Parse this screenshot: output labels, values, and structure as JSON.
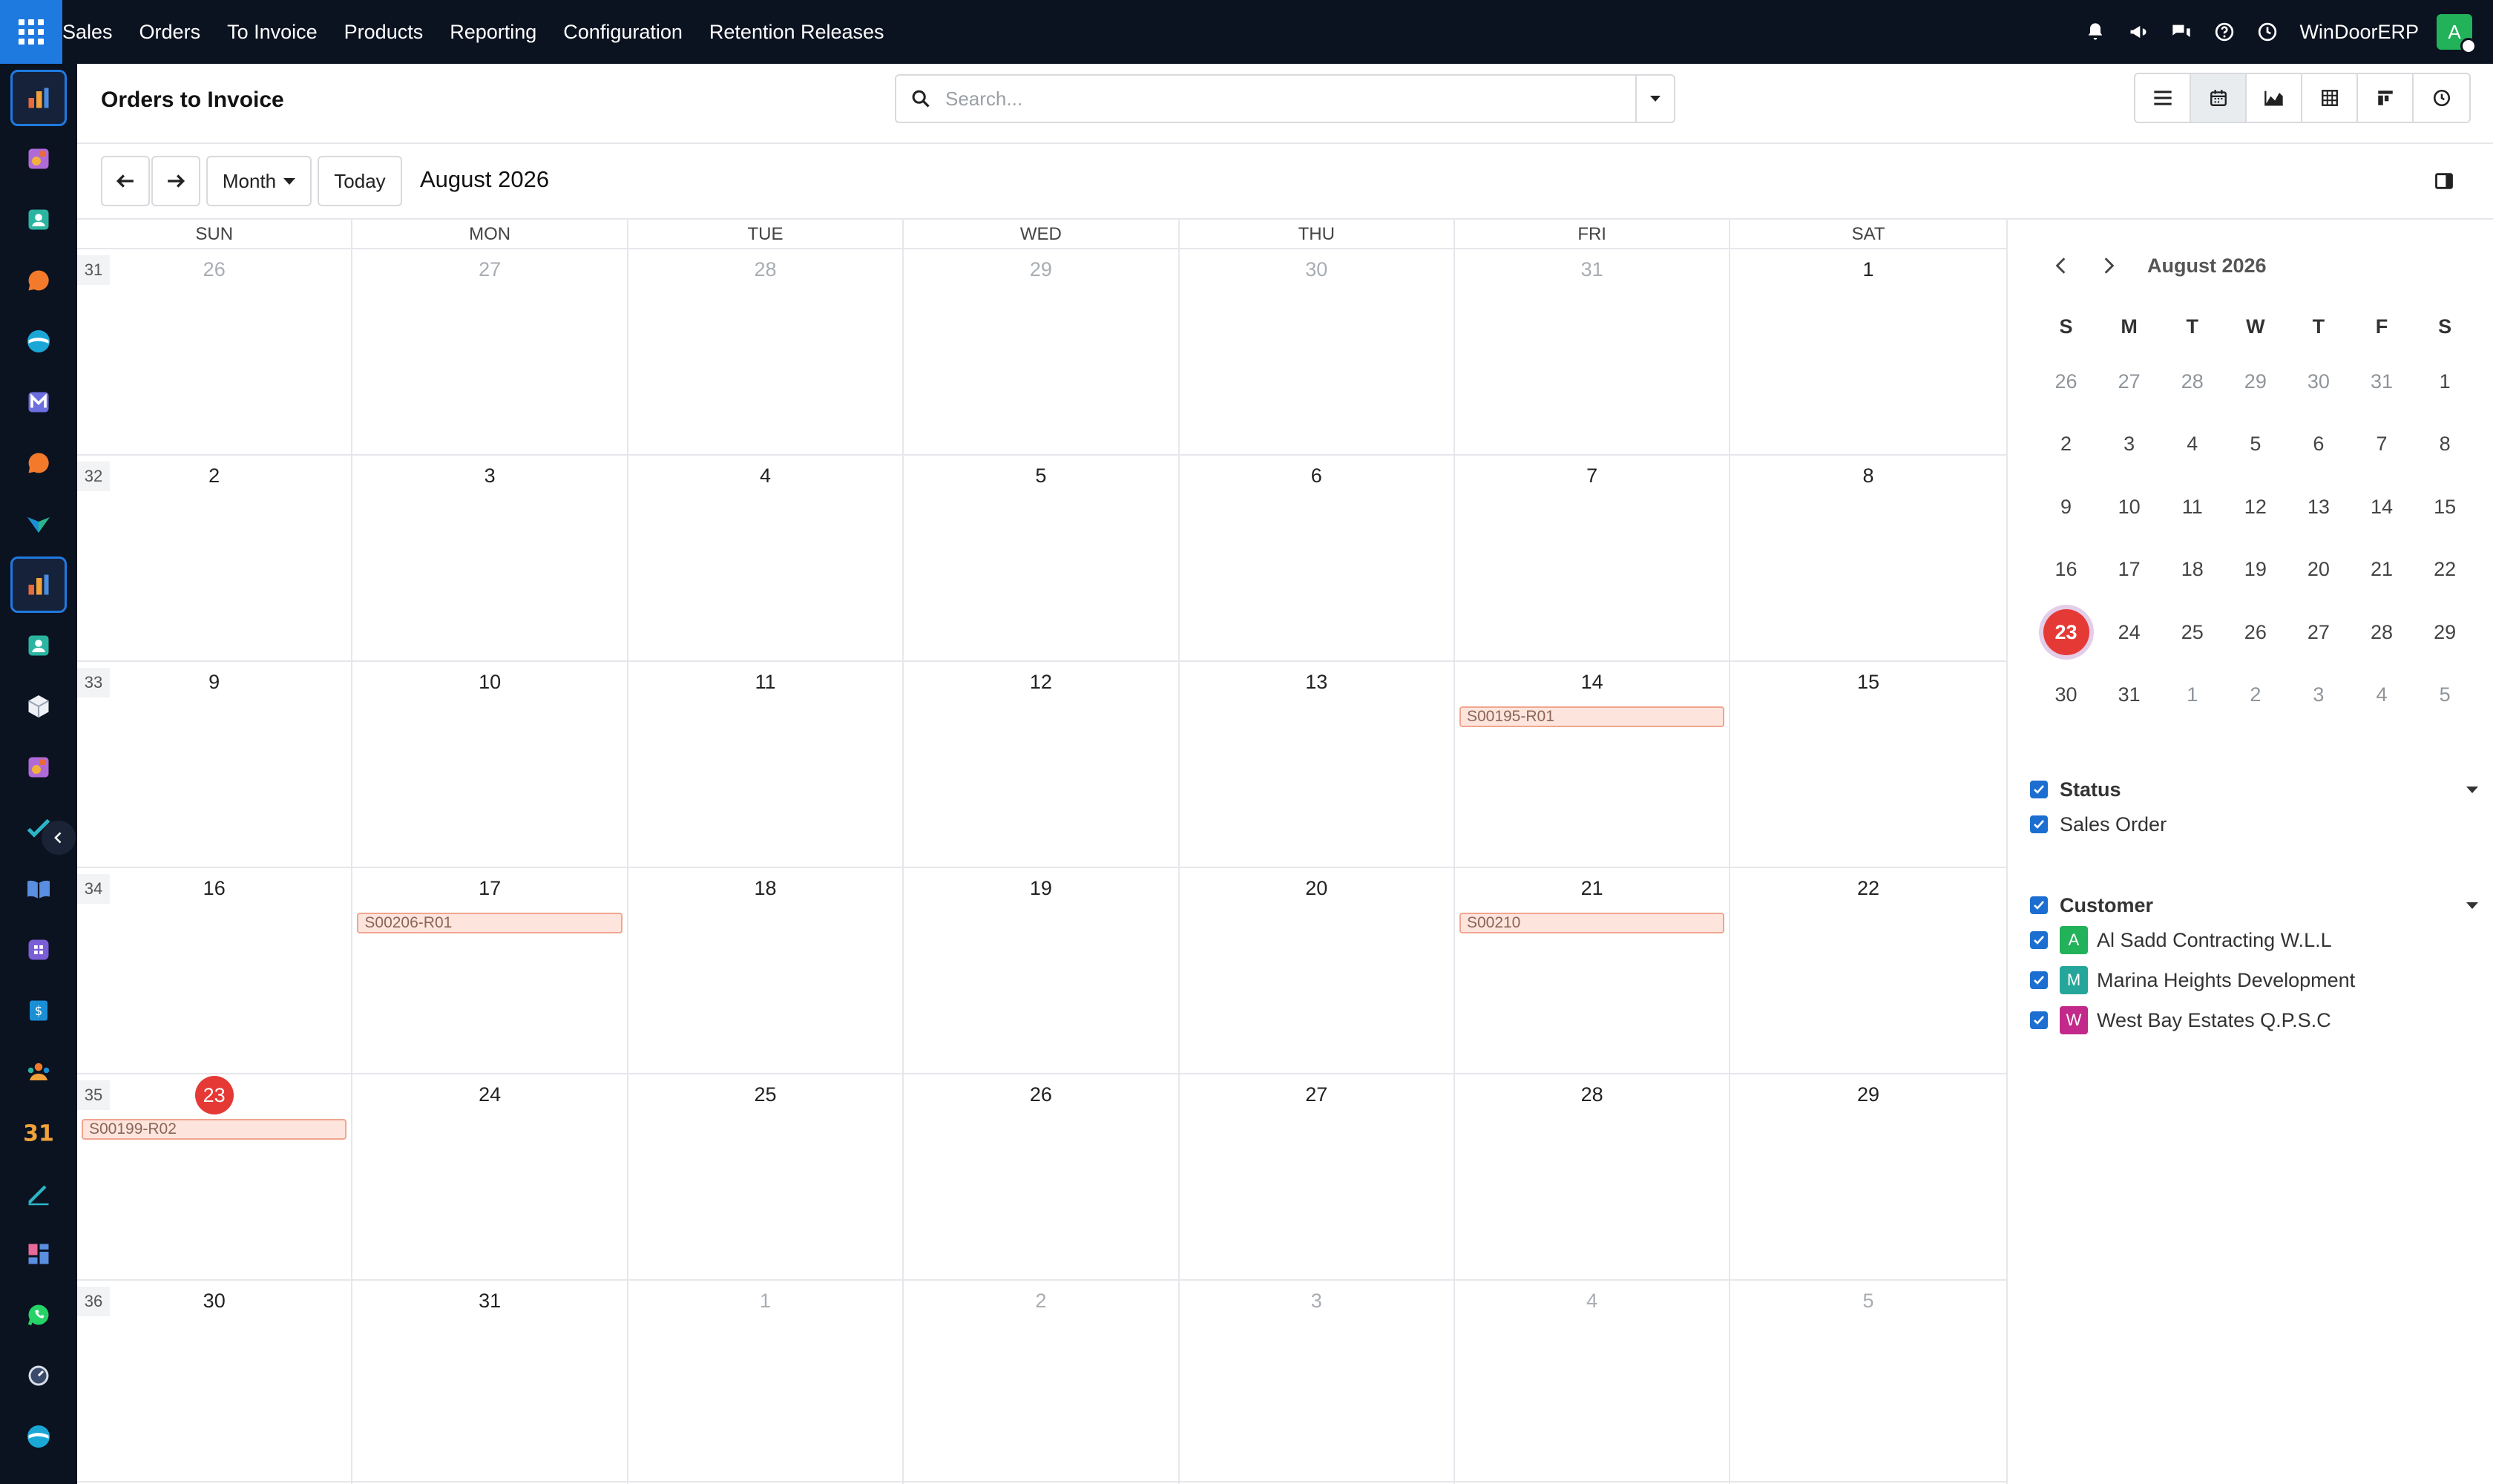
{
  "nav": {
    "menu": [
      "Sales",
      "Orders",
      "To Invoice",
      "Products",
      "Reporting",
      "Configuration",
      "Retention Releases"
    ],
    "company": "WinDoorERP",
    "user_initial": "A",
    "icons": [
      "bell-icon",
      "megaphone-icon",
      "chat-icon",
      "help-icon",
      "clock-icon"
    ]
  },
  "sidebar": {
    "apps": [
      "dashboard",
      "studio",
      "contacts",
      "discuss",
      "project",
      "mail",
      "discuss-2",
      "spreadsheet",
      "dashboard-2",
      "contacts-2",
      "inventory",
      "studio-2",
      "todo",
      "knowledge",
      "crm",
      "invoicing",
      "employees",
      "calendar",
      "sign",
      "dashboards",
      "whatsapp",
      "timer",
      "project-2"
    ]
  },
  "control": {
    "title": "Orders to Invoice",
    "search_placeholder": "Search..."
  },
  "toolbar": {
    "scale": "Month",
    "today": "Today",
    "range": "August 2026"
  },
  "calendar": {
    "weekdays": [
      "SUN",
      "MON",
      "TUE",
      "WED",
      "THU",
      "FRI",
      "SAT"
    ],
    "weeks": [
      {
        "num": "31",
        "days": [
          "26",
          "27",
          "28",
          "29",
          "30",
          "31",
          "1"
        ],
        "other": [
          true,
          true,
          true,
          true,
          true,
          true,
          false
        ]
      },
      {
        "num": "32",
        "days": [
          "2",
          "3",
          "4",
          "5",
          "6",
          "7",
          "8"
        ],
        "other": [
          false,
          false,
          false,
          false,
          false,
          false,
          false
        ]
      },
      {
        "num": "33",
        "days": [
          "9",
          "10",
          "11",
          "12",
          "13",
          "14",
          "15"
        ],
        "other": [
          false,
          false,
          false,
          false,
          false,
          false,
          false
        ]
      },
      {
        "num": "34",
        "days": [
          "16",
          "17",
          "18",
          "19",
          "20",
          "21",
          "22"
        ],
        "other": [
          false,
          false,
          false,
          false,
          false,
          false,
          false
        ]
      },
      {
        "num": "35",
        "days": [
          "23",
          "24",
          "25",
          "26",
          "27",
          "28",
          "29"
        ],
        "other": [
          false,
          false,
          false,
          false,
          false,
          false,
          false
        ]
      },
      {
        "num": "36",
        "days": [
          "30",
          "31",
          "1",
          "2",
          "3",
          "4",
          "5"
        ],
        "other": [
          false,
          false,
          true,
          true,
          true,
          true,
          true
        ]
      }
    ],
    "today": {
      "week": 4,
      "day": 0
    },
    "events": [
      {
        "week": 2,
        "day": 5,
        "label": "S00195-R01"
      },
      {
        "week": 3,
        "day": 1,
        "label": "S00206-R01"
      },
      {
        "week": 3,
        "day": 5,
        "label": "S00210"
      },
      {
        "week": 4,
        "day": 0,
        "label": "S00199-R02"
      }
    ]
  },
  "mini": {
    "title": "August 2026",
    "headers": [
      "S",
      "M",
      "T",
      "W",
      "T",
      "F",
      "S"
    ],
    "rows": [
      [
        "26",
        "27",
        "28",
        "29",
        "30",
        "31",
        "1"
      ],
      [
        "2",
        "3",
        "4",
        "5",
        "6",
        "7",
        "8"
      ],
      [
        "9",
        "10",
        "11",
        "12",
        "13",
        "14",
        "15"
      ],
      [
        "16",
        "17",
        "18",
        "19",
        "20",
        "21",
        "22"
      ],
      [
        "23",
        "24",
        "25",
        "26",
        "27",
        "28",
        "29"
      ],
      [
        "30",
        "31",
        "1",
        "2",
        "3",
        "4",
        "5"
      ]
    ],
    "other_rows": [
      [
        true,
        true,
        true,
        true,
        true,
        true,
        false
      ],
      [
        false,
        false,
        false,
        false,
        false,
        false,
        false
      ],
      [
        false,
        false,
        false,
        false,
        false,
        false,
        false
      ],
      [
        false,
        false,
        false,
        false,
        false,
        false,
        false
      ],
      [
        false,
        false,
        false,
        false,
        false,
        false,
        false
      ],
      [
        false,
        false,
        true,
        true,
        true,
        true,
        true
      ]
    ],
    "today": {
      "row": 4,
      "col": 0
    }
  },
  "filters": {
    "status": {
      "title": "Status",
      "items": [
        "Sales Order"
      ]
    },
    "customer": {
      "title": "Customer",
      "items": [
        {
          "initial": "A",
          "name": "Al Sadd Contracting W.L.L",
          "color": "#22b25a"
        },
        {
          "initial": "M",
          "name": "Marina Heights Development",
          "color": "#26a69a"
        },
        {
          "initial": "W",
          "name": "West Bay Estates Q.P.S.C",
          "color": "#c2298a"
        }
      ]
    }
  },
  "colors": {
    "accent": "#1f7ae0",
    "today": "#e53935",
    "event_bg": "#fde5dd",
    "event_border": "#f0a58f"
  }
}
